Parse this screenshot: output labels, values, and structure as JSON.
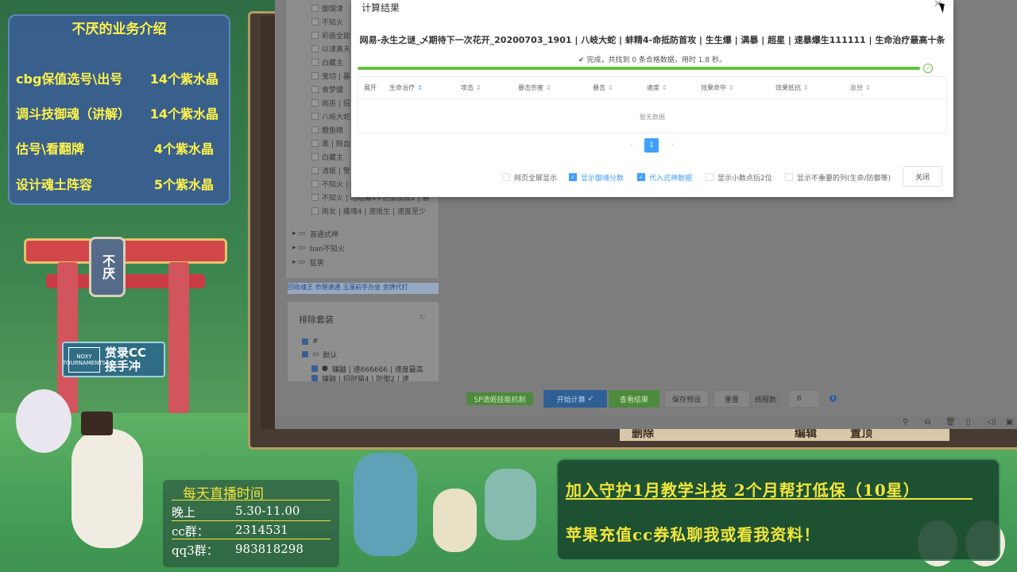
{
  "intro": {
    "title": "不厌的业务介绍",
    "rows": [
      {
        "name": "cbg保值选号\\出号",
        "price": "14个紫水晶"
      },
      {
        "name": "调斗技御魂（讲解）",
        "price": "14个紫水晶"
      },
      {
        "name": "估号\\看翻牌",
        "price": "4个紫水晶"
      },
      {
        "name": "设计魂土阵容",
        "price": "5个紫水晶"
      }
    ]
  },
  "torii_plaque": "不厌",
  "badge": {
    "box_text": "NOXY TOURNAMENTS",
    "text": "赏录CC 接手冲"
  },
  "schedule": {
    "title": "每天直播时间",
    "rows": [
      {
        "k": "晚上",
        "v": "5.30-11.00"
      },
      {
        "k": "cc群：",
        "v": "2314531"
      },
      {
        "k": "qq3群：",
        "v": "983818298"
      }
    ]
  },
  "promo": {
    "line1": "加入守护1月教学斗技  2个月帮打低保（10星）",
    "line2": "苹果充值cc券私聊我或看我资料！"
  },
  "game_strip": {
    "left": "删除",
    "mid": "编辑",
    "right": "置顶"
  },
  "tree": {
    "items": [
      "御馔津",
      "不知火",
      "彩画全能",
      "以津真天",
      "白藏主",
      "鬼切 | 暴",
      "食梦貘",
      "雨巫 | 招",
      "八岐大蛇",
      "鲤鱼精",
      "黑 | 鲜血",
      "白藏主",
      "清姬 | 警",
      "不知火 | 招",
      "不知火 | 暗暗幕4+防御加成2 | 暴",
      "雨女 | 薙魂4 | 速抵生 | 速度至少"
    ],
    "folders": [
      "普通式神",
      "ban不知火",
      "猛男"
    ]
  },
  "link_row": "回收魂王 命理速通 玉藻前手办坐 金牌代打",
  "exclude": {
    "title": "排除套装",
    "items": [
      "#",
      "默认",
      "镰鼬 | 速666666 | 速度最高",
      "镰鼬 | 招财猫4 | 防御2 | 速"
    ]
  },
  "toolbar": {
    "sp": "SP清姬技能机制",
    "start": "开始计算",
    "view": "查看结果",
    "save": "保存预设",
    "reset": "重置",
    "threads_label": "线程数:",
    "threads_value": "6"
  },
  "modal": {
    "title": "计算结果",
    "subtitle": "网易-永生之谜_乄期待下一次花开_20200703_1901 | 八岐大蛇 | 蚌精4-命抵防首攻 | 生生爆 | 满暴 | 超星 | 速暴爆生111111 | 生命治疗最高十条",
    "done": "完成，共找到 0 条合格数据，用时 1.8 秒。",
    "progress": 1.0,
    "columns": [
      "展开",
      "生命治疗",
      "攻击",
      "暴击伤害",
      "暴击",
      "速度",
      "效果命中",
      "效果抵抗",
      "总分"
    ],
    "empty": "暂无数据",
    "page": "1",
    "options": [
      {
        "label": "网页全屏显示",
        "checked": false
      },
      {
        "label": "显示御魂分数",
        "checked": true
      },
      {
        "label": "代入式神数据",
        "checked": true
      },
      {
        "label": "显示小数点后2位",
        "checked": false
      },
      {
        "label": "显示不重要的列(生命/防御等)",
        "checked": false
      }
    ],
    "close": "关闭"
  },
  "colors": {
    "accent": "#409eff",
    "success": "#67c23a",
    "yellow_text": "#fff34a"
  }
}
